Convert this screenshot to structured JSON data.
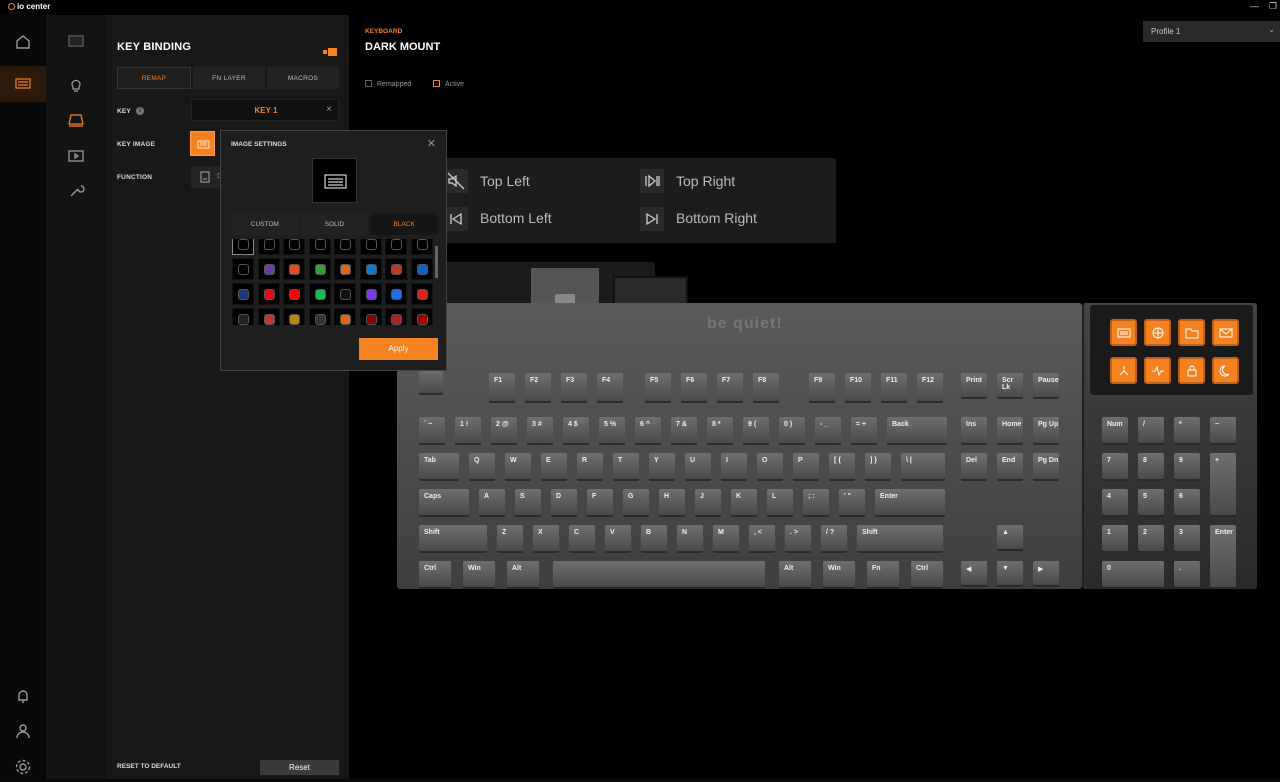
{
  "app": {
    "title": "io center"
  },
  "panel": {
    "title": "KEY BINDING",
    "tabs": [
      "REMAP",
      "FN LAYER",
      "MACROS"
    ],
    "key_label": "KEY",
    "key_value": "KEY 1",
    "key_image_label": "KEY IMAGE",
    "function_label": "FUNCTION",
    "function_value": "D",
    "reset_label": "RESET TO DEFAULT",
    "reset_button": "Reset"
  },
  "main": {
    "breadcrumb": "KEYBOARD",
    "device": "DARK MOUNT",
    "checkbox_remapped": "Remapped",
    "checkbox_active": "Active",
    "profile": "Profile 1",
    "media": {
      "top_left": "Top Left",
      "top_right": "Top Right",
      "bottom_left": "Bottom Left",
      "bottom_right": "Bottom Right"
    }
  },
  "keyboard": {
    "brand": "be quiet!",
    "fn_row": [
      "F1",
      "F2",
      "F3",
      "F4",
      "F5",
      "F6",
      "F7",
      "F8",
      "F9",
      "F10",
      "F11",
      "F12"
    ],
    "nav_top": [
      "Print",
      "Scr Lk",
      "Pause"
    ],
    "num_row": [
      "` ~",
      "1 !",
      "2 @",
      "3 #",
      "4 $",
      "5 %",
      "6 ^",
      "7 &",
      "8 *",
      "9 (",
      "0 )",
      "- _",
      "= +",
      "Back"
    ],
    "tab_row": [
      "Tab",
      "Q",
      "W",
      "E",
      "R",
      "T",
      "Y",
      "U",
      "I",
      "O",
      "P",
      "[ {",
      "] }",
      "\\ |"
    ],
    "caps_row": [
      "Caps",
      "A",
      "S",
      "D",
      "F",
      "G",
      "H",
      "J",
      "K",
      "L",
      "; :",
      "' \"",
      "Enter"
    ],
    "shift_row": [
      "Shift",
      "Z",
      "X",
      "C",
      "V",
      "B",
      "N",
      "M",
      ", <",
      ". >",
      "/ ?",
      "Shift"
    ],
    "bottom_row": [
      "Ctrl",
      "Win",
      "Alt",
      "Alt",
      "Win",
      "Fn",
      "Ctrl"
    ],
    "nav1": [
      "Ins",
      "Home",
      "Pg Up"
    ],
    "nav2": [
      "Del",
      "End",
      "Pg Dn"
    ],
    "numpad": [
      "Num",
      "/",
      "*",
      "−",
      "7",
      "8",
      "9",
      "+",
      "4",
      "5",
      "6",
      "1",
      "2",
      "3",
      "Enter",
      "0",
      "."
    ]
  },
  "dialog": {
    "title": "IMAGE SETTINGS",
    "tabs": [
      "CUSTOM",
      "SOLID",
      "BLACK"
    ],
    "apply": "Apply"
  },
  "colors": {
    "accent": "#f58220"
  }
}
